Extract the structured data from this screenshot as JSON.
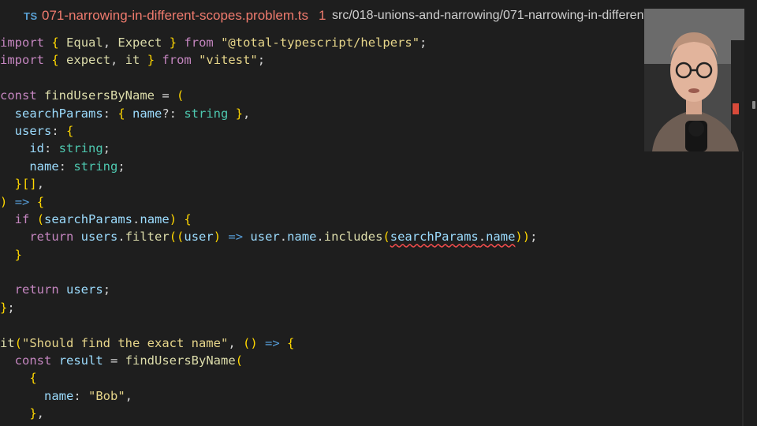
{
  "tab": {
    "language_badge": "TS",
    "filename": "071-narrowing-in-different-scopes.problem.ts",
    "problem_count": "1",
    "path": "src/018-unions-and-narrowing/071-narrowing-in-different"
  },
  "colors": {
    "background": "#1e1e1e",
    "keyword": "#c586c0",
    "string": "#e6d58a",
    "variable": "#9cdcfe",
    "function": "#dcdcaa",
    "type": "#4ec9b0",
    "error_underline": "#f14c4c",
    "tab_error_text": "#f07b6e"
  },
  "editor": {
    "lines": [
      "import { Equal, Expect } from \"@total-typescript/helpers\";",
      "import { expect, it } from \"vitest\";",
      "",
      "const findUsersByName = (",
      "  searchParams: { name?: string },",
      "  users: {",
      "    id: string;",
      "    name: string;",
      "  }[],",
      ") => {",
      "  if (searchParams.name) {",
      "    return users.filter((user) => user.name.includes(searchParams.name));",
      "  }",
      "",
      "  return users;",
      "};",
      "",
      "it(\"Should find the exact name\", () => {",
      "  const result = findUsersByName(",
      "    {",
      "      name: \"Bob\",",
      "    },"
    ]
  }
}
